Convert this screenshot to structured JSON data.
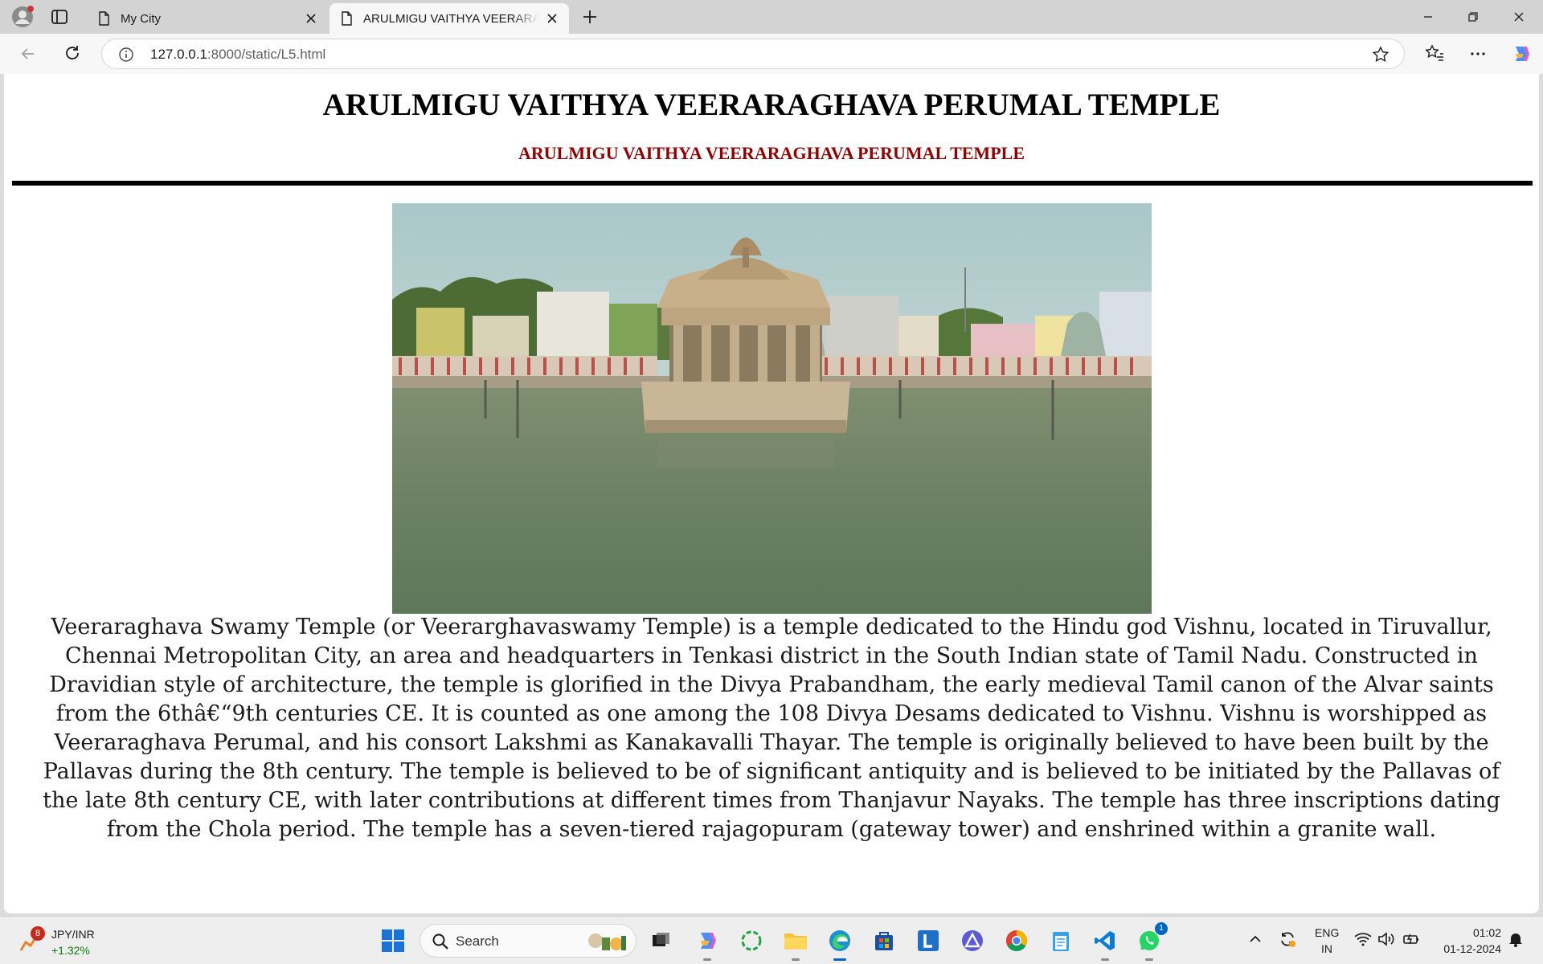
{
  "browser": {
    "tabs": [
      {
        "title": "My City"
      },
      {
        "title": "ARULMIGU VAITHYA VEERARAGHAVA PERUMAL TEMPLE"
      }
    ],
    "url_host": "127.0.0.1",
    "url_path": ":8000/static/L5.html"
  },
  "page": {
    "heading": "ARULMIGU VAITHYA VEERARAGHAVA PERUMAL TEMPLE",
    "subheading": "ARULMIGU VAITHYA VEERARAGHAVA PERUMAL TEMPLE",
    "paragraph": "Veeraraghava Swamy Temple (or Veerarghavaswamy Temple) is a temple dedicated to the Hindu god Vishnu, located in Tiruvallur, Chennai Metropolitan City, an area and headquarters in Tenkasi district in the South Indian state of Tamil Nadu. Constructed in Dravidian style of architecture, the temple is glorified in the Divya Prabandham, the early medieval Tamil canon of the Alvar saints from the 6thâ€“9th centuries CE. It is counted as one among the 108 Divya Desams dedicated to Vishnu. Vishnu is worshipped as Veeraraghava Perumal, and his consort Lakshmi as Kanakavalli Thayar. The temple is originally believed to have been built by the Pallavas during the 8th century. The temple is believed to be of significant antiquity and is believed to be initiated by the Pallavas of the late 8th century CE, with later contributions at different times from Thanjavur Nayaks. The temple has three inscriptions dating from the Chola period. The temple has a seven-tiered rajagopuram (gateway tower) and enshrined within a granite wall."
  },
  "taskbar": {
    "weather_badge": "8",
    "ticker_name": "JPY/INR",
    "ticker_change": "+1.32%",
    "search_label": "Search",
    "whatsapp_badge": "1",
    "lang_line1": "ENG",
    "lang_line2": "IN",
    "time": "01:02",
    "date": "01-12-2024"
  },
  "colors": {
    "subheading": "#8b0000",
    "accent": "#0067c0"
  }
}
